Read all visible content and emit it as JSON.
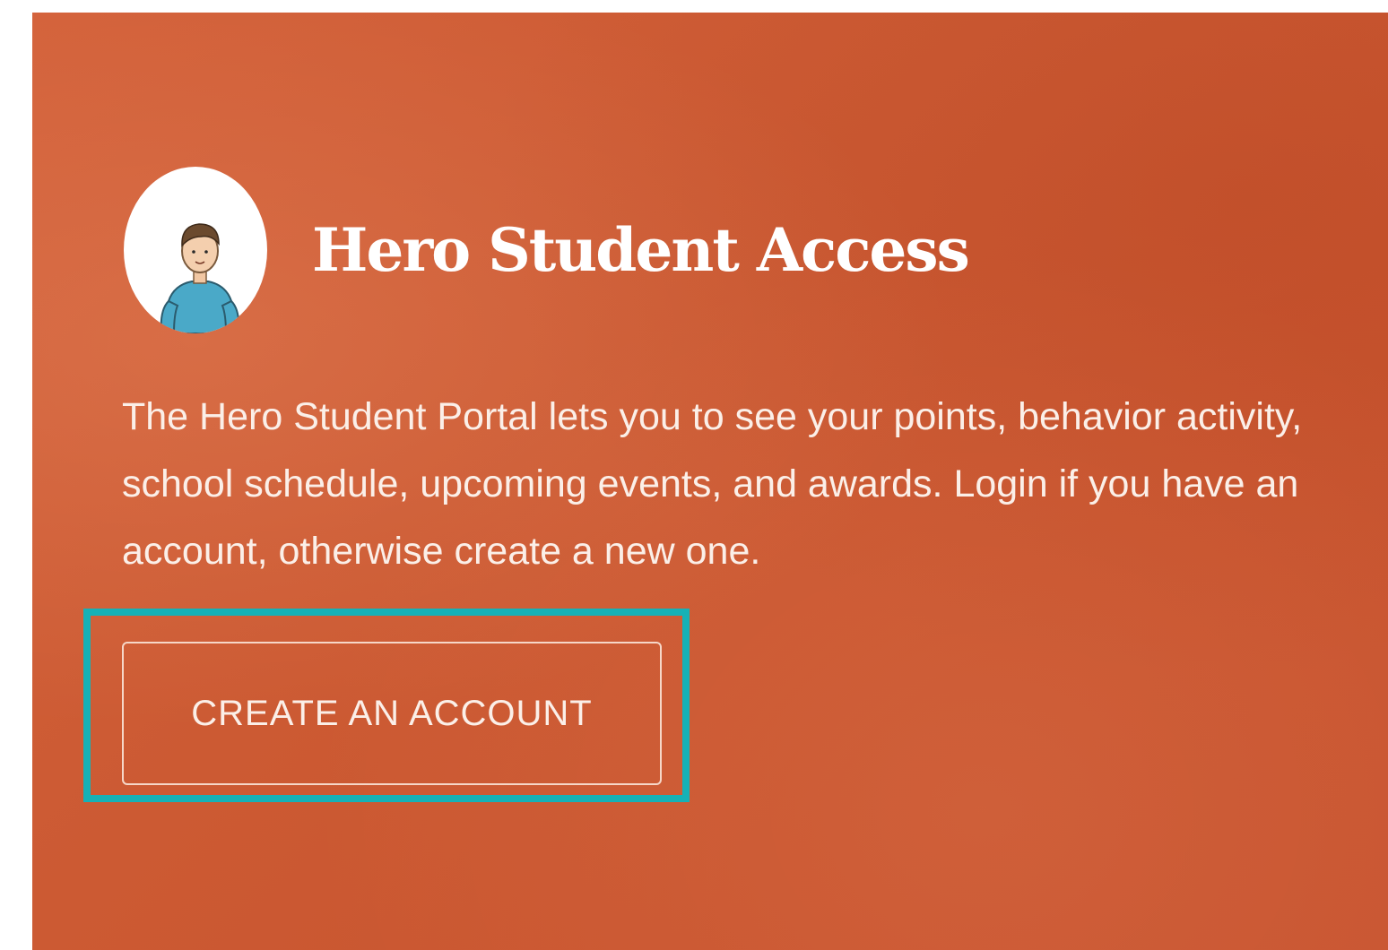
{
  "portal": {
    "title": "Hero Student Access",
    "description": "The Hero Student Portal lets you to see your points, behavior activity, school schedule, upcoming events, and awards. Login if you have an account, otherwise create a new one.",
    "create_account_label": "CREATE AN ACCOUNT",
    "avatar_icon": "student-avatar-icon"
  },
  "colors": {
    "panel_background": "#cc5a33",
    "text": "#ffffff",
    "highlight_border": "#16b1b6"
  }
}
